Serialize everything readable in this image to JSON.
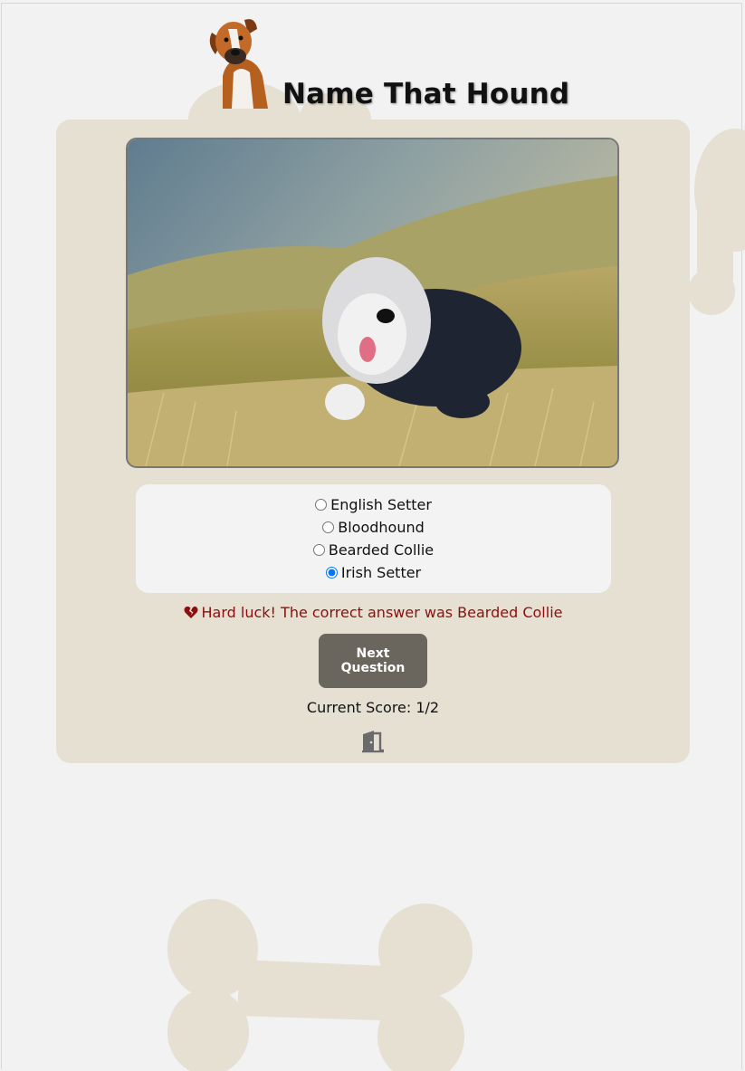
{
  "header": {
    "title": "Name That Hound",
    "logo_icon": "boxer-dog-logo"
  },
  "quiz": {
    "photo_subject": "bearded-collie-photo",
    "options": [
      {
        "label": "English Setter",
        "selected": false
      },
      {
        "label": "Bloodhound",
        "selected": false
      },
      {
        "label": "Bearded Collie",
        "selected": false
      },
      {
        "label": "Irish Setter",
        "selected": true
      }
    ],
    "feedback": "Hard luck! The correct answer was Bearded Collie",
    "feedback_icon": "broken-heart-icon",
    "next_label": "Next Question",
    "score_text": "Current Score: 1/2",
    "exit_icon": "door-exit-icon"
  },
  "colors": {
    "background": "#f2f2f2",
    "card": "#e6e0d2",
    "bone": "#e6e0d2",
    "button": "#6a665e",
    "feedback": "#8b0f0f",
    "radio_selected": "#1a73e8"
  }
}
